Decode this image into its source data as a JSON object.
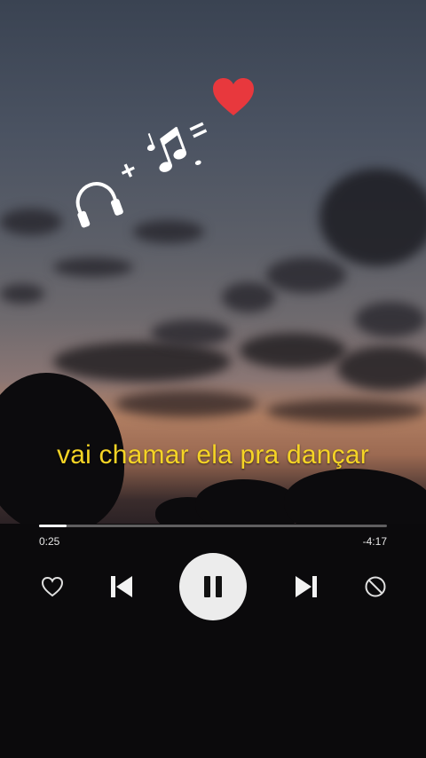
{
  "overlay": {
    "sticker": {
      "headphones_icon": "headphones-icon",
      "plus_symbol": "+",
      "notes_icon": "music-notes-icon",
      "equals_symbol": "=",
      "heart_icon": "red-heart-icon",
      "heart_color": "#e8383d"
    }
  },
  "lyrics": {
    "current_line": "vai chamar ela pra dançar",
    "color": "#f5d425"
  },
  "player": {
    "elapsed": "0:25",
    "remaining": "-4:17",
    "progress": 0.08,
    "buttons": {
      "like_icon": "heart-outline-icon",
      "previous_icon": "skip-previous-icon",
      "pause_icon": "pause-icon",
      "next_icon": "skip-next-icon",
      "block_icon": "block-icon"
    }
  }
}
